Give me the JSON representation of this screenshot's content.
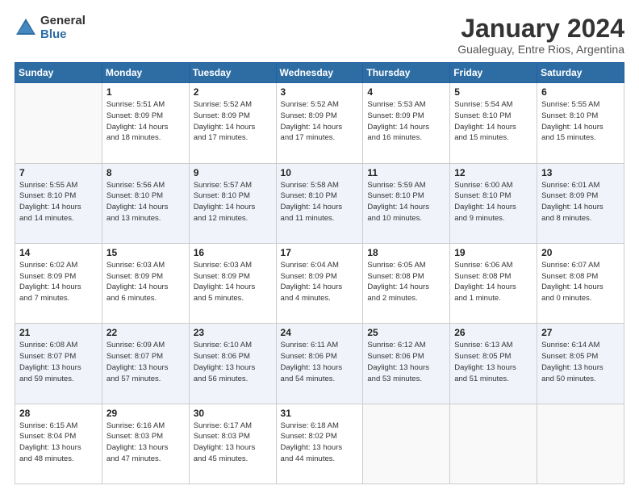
{
  "logo": {
    "general": "General",
    "blue": "Blue"
  },
  "title": {
    "month": "January 2024",
    "location": "Gualeguay, Entre Rios, Argentina"
  },
  "days_of_week": [
    "Sunday",
    "Monday",
    "Tuesday",
    "Wednesday",
    "Thursday",
    "Friday",
    "Saturday"
  ],
  "weeks": [
    [
      {
        "day": null,
        "sunrise": null,
        "sunset": null,
        "daylight": null
      },
      {
        "day": "1",
        "sunrise": "Sunrise: 5:51 AM",
        "sunset": "Sunset: 8:09 PM",
        "daylight": "Daylight: 14 hours and 18 minutes."
      },
      {
        "day": "2",
        "sunrise": "Sunrise: 5:52 AM",
        "sunset": "Sunset: 8:09 PM",
        "daylight": "Daylight: 14 hours and 17 minutes."
      },
      {
        "day": "3",
        "sunrise": "Sunrise: 5:52 AM",
        "sunset": "Sunset: 8:09 PM",
        "daylight": "Daylight: 14 hours and 17 minutes."
      },
      {
        "day": "4",
        "sunrise": "Sunrise: 5:53 AM",
        "sunset": "Sunset: 8:09 PM",
        "daylight": "Daylight: 14 hours and 16 minutes."
      },
      {
        "day": "5",
        "sunrise": "Sunrise: 5:54 AM",
        "sunset": "Sunset: 8:10 PM",
        "daylight": "Daylight: 14 hours and 15 minutes."
      },
      {
        "day": "6",
        "sunrise": "Sunrise: 5:55 AM",
        "sunset": "Sunset: 8:10 PM",
        "daylight": "Daylight: 14 hours and 15 minutes."
      }
    ],
    [
      {
        "day": "7",
        "sunrise": "Sunrise: 5:55 AM",
        "sunset": "Sunset: 8:10 PM",
        "daylight": "Daylight: 14 hours and 14 minutes."
      },
      {
        "day": "8",
        "sunrise": "Sunrise: 5:56 AM",
        "sunset": "Sunset: 8:10 PM",
        "daylight": "Daylight: 14 hours and 13 minutes."
      },
      {
        "day": "9",
        "sunrise": "Sunrise: 5:57 AM",
        "sunset": "Sunset: 8:10 PM",
        "daylight": "Daylight: 14 hours and 12 minutes."
      },
      {
        "day": "10",
        "sunrise": "Sunrise: 5:58 AM",
        "sunset": "Sunset: 8:10 PM",
        "daylight": "Daylight: 14 hours and 11 minutes."
      },
      {
        "day": "11",
        "sunrise": "Sunrise: 5:59 AM",
        "sunset": "Sunset: 8:10 PM",
        "daylight": "Daylight: 14 hours and 10 minutes."
      },
      {
        "day": "12",
        "sunrise": "Sunrise: 6:00 AM",
        "sunset": "Sunset: 8:10 PM",
        "daylight": "Daylight: 14 hours and 9 minutes."
      },
      {
        "day": "13",
        "sunrise": "Sunrise: 6:01 AM",
        "sunset": "Sunset: 8:09 PM",
        "daylight": "Daylight: 14 hours and 8 minutes."
      }
    ],
    [
      {
        "day": "14",
        "sunrise": "Sunrise: 6:02 AM",
        "sunset": "Sunset: 8:09 PM",
        "daylight": "Daylight: 14 hours and 7 minutes."
      },
      {
        "day": "15",
        "sunrise": "Sunrise: 6:03 AM",
        "sunset": "Sunset: 8:09 PM",
        "daylight": "Daylight: 14 hours and 6 minutes."
      },
      {
        "day": "16",
        "sunrise": "Sunrise: 6:03 AM",
        "sunset": "Sunset: 8:09 PM",
        "daylight": "Daylight: 14 hours and 5 minutes."
      },
      {
        "day": "17",
        "sunrise": "Sunrise: 6:04 AM",
        "sunset": "Sunset: 8:09 PM",
        "daylight": "Daylight: 14 hours and 4 minutes."
      },
      {
        "day": "18",
        "sunrise": "Sunrise: 6:05 AM",
        "sunset": "Sunset: 8:08 PM",
        "daylight": "Daylight: 14 hours and 2 minutes."
      },
      {
        "day": "19",
        "sunrise": "Sunrise: 6:06 AM",
        "sunset": "Sunset: 8:08 PM",
        "daylight": "Daylight: 14 hours and 1 minute."
      },
      {
        "day": "20",
        "sunrise": "Sunrise: 6:07 AM",
        "sunset": "Sunset: 8:08 PM",
        "daylight": "Daylight: 14 hours and 0 minutes."
      }
    ],
    [
      {
        "day": "21",
        "sunrise": "Sunrise: 6:08 AM",
        "sunset": "Sunset: 8:07 PM",
        "daylight": "Daylight: 13 hours and 59 minutes."
      },
      {
        "day": "22",
        "sunrise": "Sunrise: 6:09 AM",
        "sunset": "Sunset: 8:07 PM",
        "daylight": "Daylight: 13 hours and 57 minutes."
      },
      {
        "day": "23",
        "sunrise": "Sunrise: 6:10 AM",
        "sunset": "Sunset: 8:06 PM",
        "daylight": "Daylight: 13 hours and 56 minutes."
      },
      {
        "day": "24",
        "sunrise": "Sunrise: 6:11 AM",
        "sunset": "Sunset: 8:06 PM",
        "daylight": "Daylight: 13 hours and 54 minutes."
      },
      {
        "day": "25",
        "sunrise": "Sunrise: 6:12 AM",
        "sunset": "Sunset: 8:06 PM",
        "daylight": "Daylight: 13 hours and 53 minutes."
      },
      {
        "day": "26",
        "sunrise": "Sunrise: 6:13 AM",
        "sunset": "Sunset: 8:05 PM",
        "daylight": "Daylight: 13 hours and 51 minutes."
      },
      {
        "day": "27",
        "sunrise": "Sunrise: 6:14 AM",
        "sunset": "Sunset: 8:05 PM",
        "daylight": "Daylight: 13 hours and 50 minutes."
      }
    ],
    [
      {
        "day": "28",
        "sunrise": "Sunrise: 6:15 AM",
        "sunset": "Sunset: 8:04 PM",
        "daylight": "Daylight: 13 hours and 48 minutes."
      },
      {
        "day": "29",
        "sunrise": "Sunrise: 6:16 AM",
        "sunset": "Sunset: 8:03 PM",
        "daylight": "Daylight: 13 hours and 47 minutes."
      },
      {
        "day": "30",
        "sunrise": "Sunrise: 6:17 AM",
        "sunset": "Sunset: 8:03 PM",
        "daylight": "Daylight: 13 hours and 45 minutes."
      },
      {
        "day": "31",
        "sunrise": "Sunrise: 6:18 AM",
        "sunset": "Sunset: 8:02 PM",
        "daylight": "Daylight: 13 hours and 44 minutes."
      },
      {
        "day": null,
        "sunrise": null,
        "sunset": null,
        "daylight": null
      },
      {
        "day": null,
        "sunrise": null,
        "sunset": null,
        "daylight": null
      },
      {
        "day": null,
        "sunrise": null,
        "sunset": null,
        "daylight": null
      }
    ]
  ]
}
